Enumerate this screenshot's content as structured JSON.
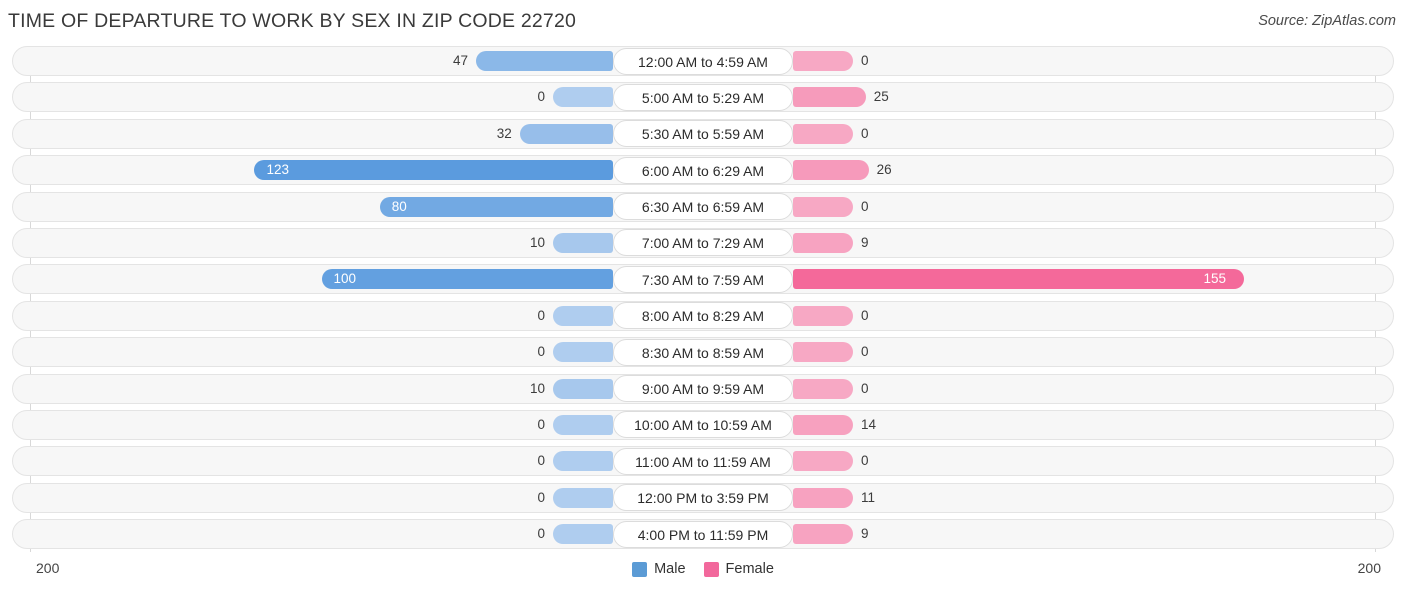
{
  "header": {
    "title": "TIME OF DEPARTURE TO WORK BY SEX IN ZIP CODE 22720",
    "source": "Source: ZipAtlas.com"
  },
  "axis": {
    "left_max_label": "200",
    "right_max_label": "200"
  },
  "legend": [
    {
      "label": "Male",
      "color": "#5B9BD5"
    },
    {
      "label": "Female",
      "color": "#F2689C"
    }
  ],
  "colors": {
    "male_base": "#5B9BDE",
    "female_base": "#F4699A",
    "male_zero": "#AFCDEF",
    "female_zero": "#F7A8C4",
    "track_fill": "#F7F7F7",
    "track_border": "#E4E4E4",
    "axis_line": "#D8D8D8"
  },
  "chart_data": {
    "type": "bar",
    "title": "TIME OF DEPARTURE TO WORK BY SEX IN ZIP CODE 22720",
    "orientation": "horizontal-diverging",
    "xlabel": "",
    "ylabel": "",
    "xlim": [
      200,
      200
    ],
    "grid": false,
    "legend_position": "bottom-center",
    "categories": [
      "12:00 AM to 4:59 AM",
      "5:00 AM to 5:29 AM",
      "5:30 AM to 5:59 AM",
      "6:00 AM to 6:29 AM",
      "6:30 AM to 6:59 AM",
      "7:00 AM to 7:29 AM",
      "7:30 AM to 7:59 AM",
      "8:00 AM to 8:29 AM",
      "8:30 AM to 8:59 AM",
      "9:00 AM to 9:59 AM",
      "10:00 AM to 10:59 AM",
      "11:00 AM to 11:59 AM",
      "12:00 PM to 3:59 PM",
      "4:00 PM to 11:59 PM"
    ],
    "series": [
      {
        "name": "Male",
        "values": [
          47,
          0,
          32,
          123,
          80,
          10,
          100,
          0,
          0,
          10,
          0,
          0,
          0,
          0
        ]
      },
      {
        "name": "Female",
        "values": [
          0,
          25,
          0,
          26,
          0,
          9,
          155,
          0,
          0,
          0,
          14,
          0,
          11,
          9
        ]
      }
    ]
  }
}
